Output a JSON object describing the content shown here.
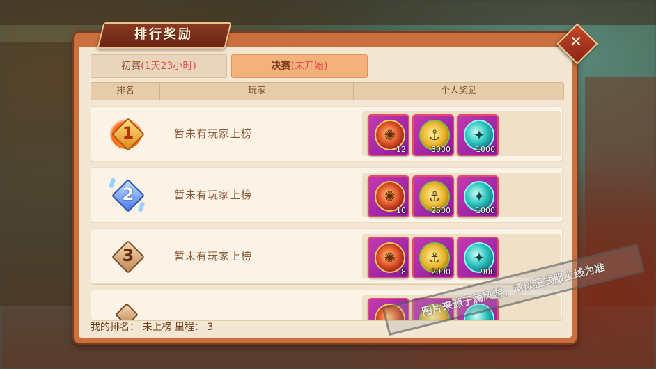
{
  "dialog": {
    "title": "排行奖励",
    "close_label": "✕"
  },
  "tabs": [
    {
      "name": "初赛",
      "status": "(1天23小时)",
      "selected": false
    },
    {
      "name": "决赛",
      "status": "(未开始)",
      "selected": true
    }
  ],
  "table": {
    "headers": {
      "rank": "排名",
      "player": "玩家",
      "reward": "个人奖励"
    },
    "rows": [
      {
        "rank": "1",
        "player": "暂未有玩家上榜",
        "rewards": [
          {
            "icon": "medal-icon",
            "qty": "12"
          },
          {
            "icon": "anchor-icon",
            "qty": "3000"
          },
          {
            "icon": "globe-icon",
            "qty": "1000"
          }
        ]
      },
      {
        "rank": "2",
        "player": "暂未有玩家上榜",
        "rewards": [
          {
            "icon": "medal-icon",
            "qty": "10"
          },
          {
            "icon": "anchor-icon",
            "qty": "2500"
          },
          {
            "icon": "globe-icon",
            "qty": "1000"
          }
        ]
      },
      {
        "rank": "3",
        "player": "暂未有玩家上榜",
        "rewards": [
          {
            "icon": "medal-icon",
            "qty": "8"
          },
          {
            "icon": "anchor-icon",
            "qty": "2000"
          },
          {
            "icon": "globe-icon",
            "qty": "900"
          }
        ]
      }
    ]
  },
  "footer": {
    "text": "我的排名： 未上榜 里程： 3"
  },
  "watermark": "图片来源于澜风游，请以正式服上线为准",
  "colors": {
    "panel_border": "#c9703e",
    "panel_bg": "#f3e6d3",
    "tab_active": "#f3b27c",
    "status_red": "#e0524a",
    "item_border": "#e64a6a"
  }
}
